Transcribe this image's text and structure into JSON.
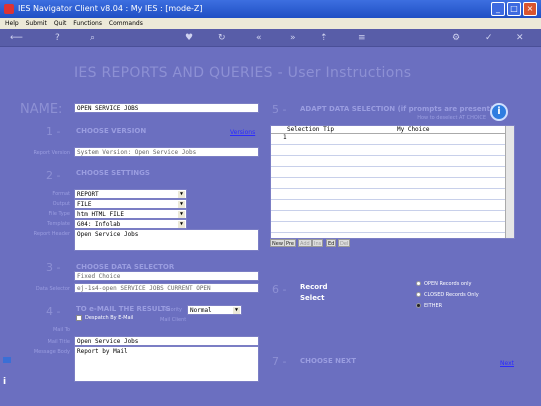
{
  "window": {
    "title": "IES Navigator Client v8.04 : My IES :     [mode-Z]"
  },
  "menu": [
    "Help",
    "Submit",
    "Quit",
    "Functions",
    "Commands"
  ],
  "page": {
    "heading": "IES REPORTS AND QUERIES -   User Instructions",
    "name_label": "NAME:",
    "name_value": "OPEN SERVICE JOBS"
  },
  "step1": {
    "num": "1 -",
    "title": "CHOOSE VERSION",
    "link": "Versions",
    "lbl_version": "Report Version",
    "version_value": "System Version: Open Service Jobs"
  },
  "step2": {
    "num": "2 -",
    "title": "CHOOSE SETTINGS",
    "lbl_format": "Format",
    "format": "REPORT",
    "lbl_output": "Output",
    "output": "FILE",
    "lbl_filetype": "File Type",
    "filetype": "htm HTML FILE",
    "lbl_template": "Template",
    "template": "G04: Infolab",
    "lbl_header": "Report Header",
    "header": "Open Service Jobs"
  },
  "step3": {
    "num": "3 -",
    "title": "CHOOSE DATA SELECTOR",
    "fixed": "Fixed Choice",
    "lbl_selector": "Data Selector",
    "selector": "ej-1s4-open SERVICE JOBS CURRENT OPEN"
  },
  "step4": {
    "num": "4 -",
    "title": "TO e-MAIL THE RESULTS",
    "priority_label": "Priority",
    "priority": "Normal",
    "despatch": "Despatch By E-Mail",
    "mail_client": "Mail Client",
    "lbl_mailto": "Mail To",
    "lbl_title": "Mail Title",
    "mail_title": "Open Service Jobs",
    "lbl_body": "Message Body",
    "mail_body": "Report by Mail"
  },
  "step5": {
    "num": "5 -",
    "title": "ADAPT DATA SELECTION (if prompts are present)",
    "hint": "How to deselect AT CHOICE",
    "col1": "Selection Tip",
    "col2": "My Choice",
    "row1": "1",
    "buttons": [
      "New",
      "Pre",
      "Add",
      "Ins",
      "Ed",
      "Del"
    ]
  },
  "step6": {
    "num": "6 -",
    "title1": "Record",
    "title2": "Select",
    "options": [
      "OPEN Records only",
      "CLOSED Records Only",
      "EITHER"
    ],
    "selected": 2
  },
  "step7": {
    "num": "7 -",
    "title": "CHOOSE NEXT",
    "link": "Next"
  }
}
